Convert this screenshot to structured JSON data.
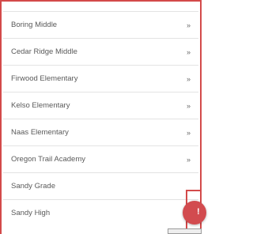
{
  "schools": [
    {
      "label": "Boring Middle",
      "chevron": "»"
    },
    {
      "label": "Cedar Ridge Middle",
      "chevron": "»"
    },
    {
      "label": "Firwood Elementary",
      "chevron": "»"
    },
    {
      "label": "Kelso Elementary",
      "chevron": "»"
    },
    {
      "label": "Naas Elementary",
      "chevron": "»"
    },
    {
      "label": "Oregon Trail Academy",
      "chevron": "»"
    },
    {
      "label": "Sandy Grade",
      "chevron": ""
    },
    {
      "label": "Sandy High",
      "chevron": ""
    }
  ],
  "fab": {
    "mark": "!"
  },
  "colors": {
    "accent": "#d34a4a",
    "text": "#5a5a5a",
    "divider": "#e3e3e3"
  },
  "icons": {
    "chevron": "double-chevron-right-icon",
    "fab": "alert-icon"
  }
}
